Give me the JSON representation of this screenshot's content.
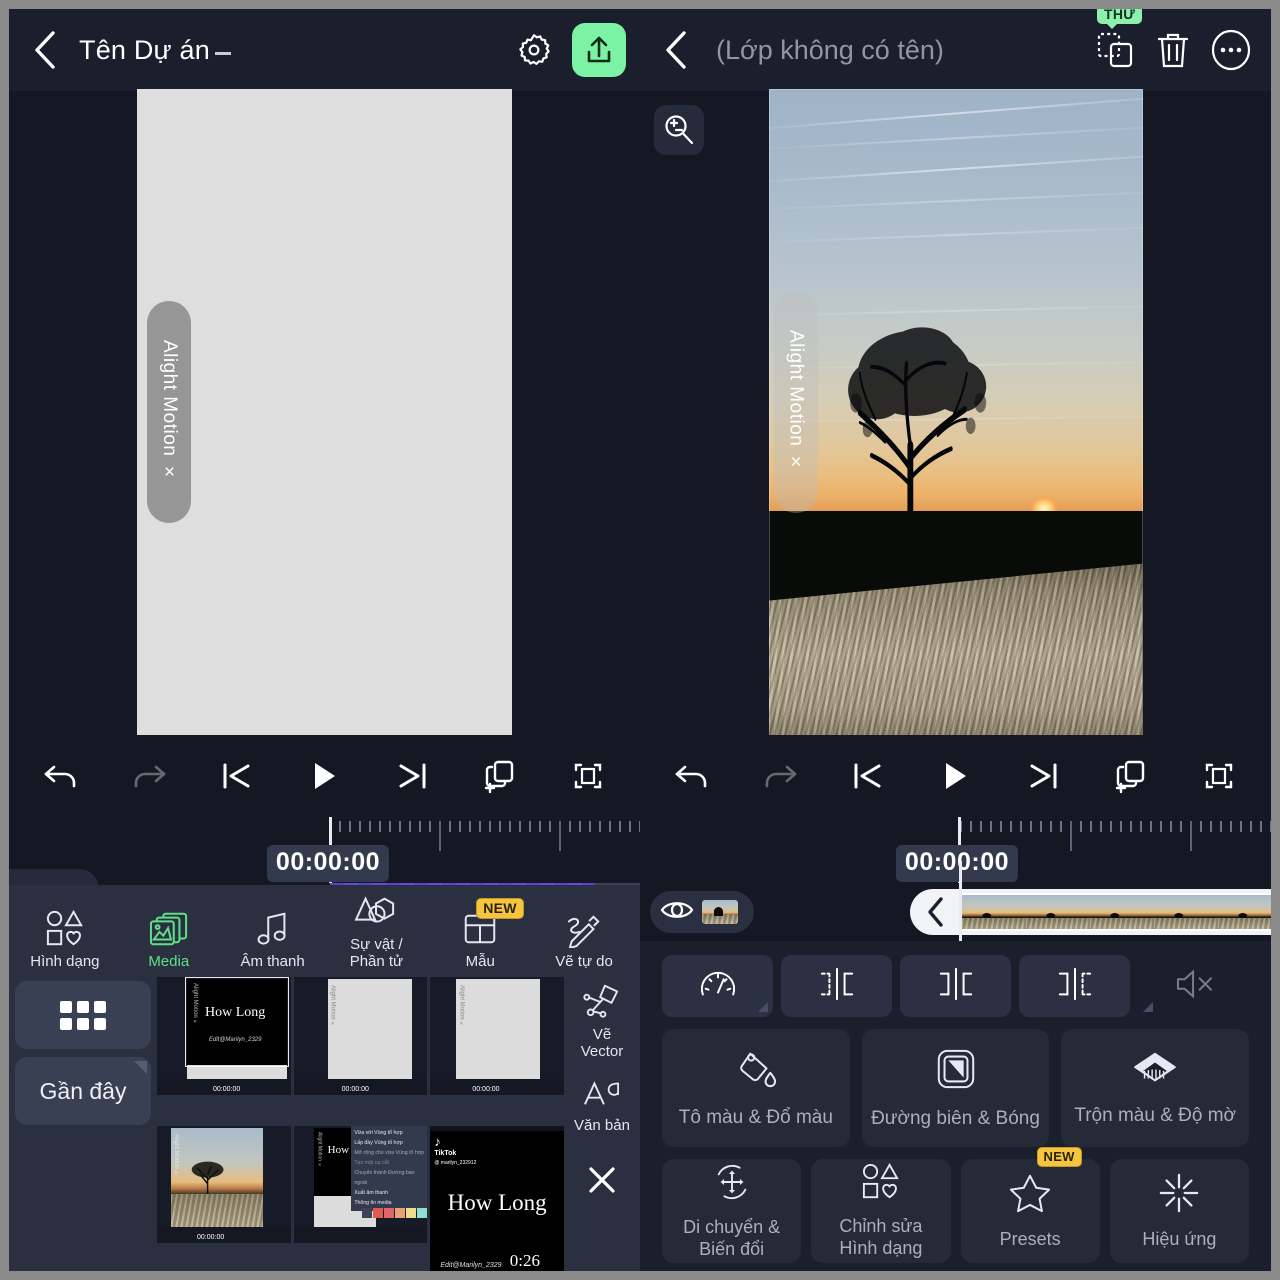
{
  "app": {
    "name": "Alight Motion",
    "watermark": "Alight Motion ×"
  },
  "left_panel": {
    "header": {
      "back_icon": "chevron-left-icon",
      "project_title": "Tên Dự án",
      "settings_icon": "gear-icon",
      "export_icon": "share-upload-icon",
      "export_color": "#7cf2a4"
    },
    "playback": {
      "undo": "undo-icon",
      "redo": "redo-icon",
      "skip_start": "skip-to-start-icon",
      "play": "play-icon",
      "skip_end": "skip-to-end-icon",
      "add_layer": "add-layer-icon",
      "fit": "fit-frame-icon"
    },
    "timeline": {
      "timecode": "00:00:00",
      "clip_color": "#5b3fd6"
    },
    "sheet": {
      "categories": [
        {
          "label": "Hình dạng",
          "icon": "shapes-icon",
          "active": false,
          "badge": ""
        },
        {
          "label": "Media",
          "icon": "media-stack-icon",
          "active": true,
          "badge": ""
        },
        {
          "label": "Âm thanh",
          "icon": "music-note-icon",
          "active": false,
          "badge": ""
        },
        {
          "label": "Sự vật /\nPhần tử",
          "icon": "elements-icon",
          "active": false,
          "badge": ""
        },
        {
          "label": "Mẫu",
          "icon": "template-icon",
          "active": false,
          "badge": "NEW"
        },
        {
          "label": "Vẽ tự do",
          "icon": "freehand-draw-icon",
          "active": false,
          "badge": ""
        }
      ],
      "grid_button": "grid-icon",
      "recent_label": "Gần đây",
      "side_tools": [
        {
          "label": "Vẽ\nVector",
          "icon": "vector-pen-icon"
        },
        {
          "label": "Văn bản",
          "icon": "text-aa-icon"
        }
      ],
      "close_icon": "close-icon",
      "thumbnails": [
        {
          "name": "thumb-how-long-edit",
          "caption": "How Long"
        },
        {
          "name": "thumb-blank-project-1",
          "caption": ""
        },
        {
          "name": "thumb-blank-project-2",
          "caption": ""
        },
        {
          "name": "thumb-sunset-photo",
          "caption": ""
        },
        {
          "name": "thumb-context-menu",
          "caption": "How"
        },
        {
          "name": "thumb-tiktok-how-long",
          "caption": "How Long"
        }
      ],
      "thumb_menu_items": [
        "Vừa với Vùng tổ hợp",
        "Lấp đầy Vùng tổ hợp",
        "Mở rộng cho vừa Vùng tổ hợp",
        "Tạo mặt nạ cắt",
        "Chuyển thành Đường bao ngoài",
        "Xuất âm thanh",
        "Thông tin media"
      ],
      "tiktok_user": "@ marilyn_232912",
      "tiktok_label": "TikTok"
    }
  },
  "right_panel": {
    "header": {
      "back_icon": "chevron-left-icon",
      "layer_title": "(Lớp không có tên)",
      "duplicate_icon": "duplicate-layer-icon",
      "duplicate_badge": "THỬ",
      "delete_icon": "trash-icon",
      "more_icon": "more-options-icon"
    },
    "zoom_tool": "zoom-in-out-icon",
    "timeline": {
      "timecode": "00:00:00"
    },
    "tools_row_small": [
      {
        "name": "speed-tool",
        "icon": "speedometer-icon"
      },
      {
        "name": "trim-left-tool",
        "icon": "split-left-icon"
      },
      {
        "name": "split-tool",
        "icon": "split-center-icon"
      },
      {
        "name": "trim-right-tool",
        "icon": "split-right-icon"
      },
      {
        "name": "mute-tool",
        "icon": "mute-speaker-icon"
      }
    ],
    "tools_row_medium": [
      {
        "label": "Tô màu & Đổ màu",
        "icon": "paint-bucket-icon",
        "badge": ""
      },
      {
        "label": "Đường biên & Bóng",
        "icon": "border-shadow-icon",
        "badge": ""
      },
      {
        "label": "Trộn màu & Độ mờ",
        "icon": "blend-opacity-icon",
        "badge": ""
      }
    ],
    "tools_row_square": [
      {
        "label": "Di chuyển &\nBiến đổi",
        "icon": "move-transform-icon",
        "badge": ""
      },
      {
        "label": "Chỉnh sửa\nHình dạng",
        "icon": "shapes-icon",
        "badge": ""
      },
      {
        "label": "Presets",
        "icon": "star-icon",
        "badge": "NEW"
      },
      {
        "label": "Hiệu ứng",
        "icon": "effects-burst-icon",
        "badge": ""
      }
    ]
  }
}
